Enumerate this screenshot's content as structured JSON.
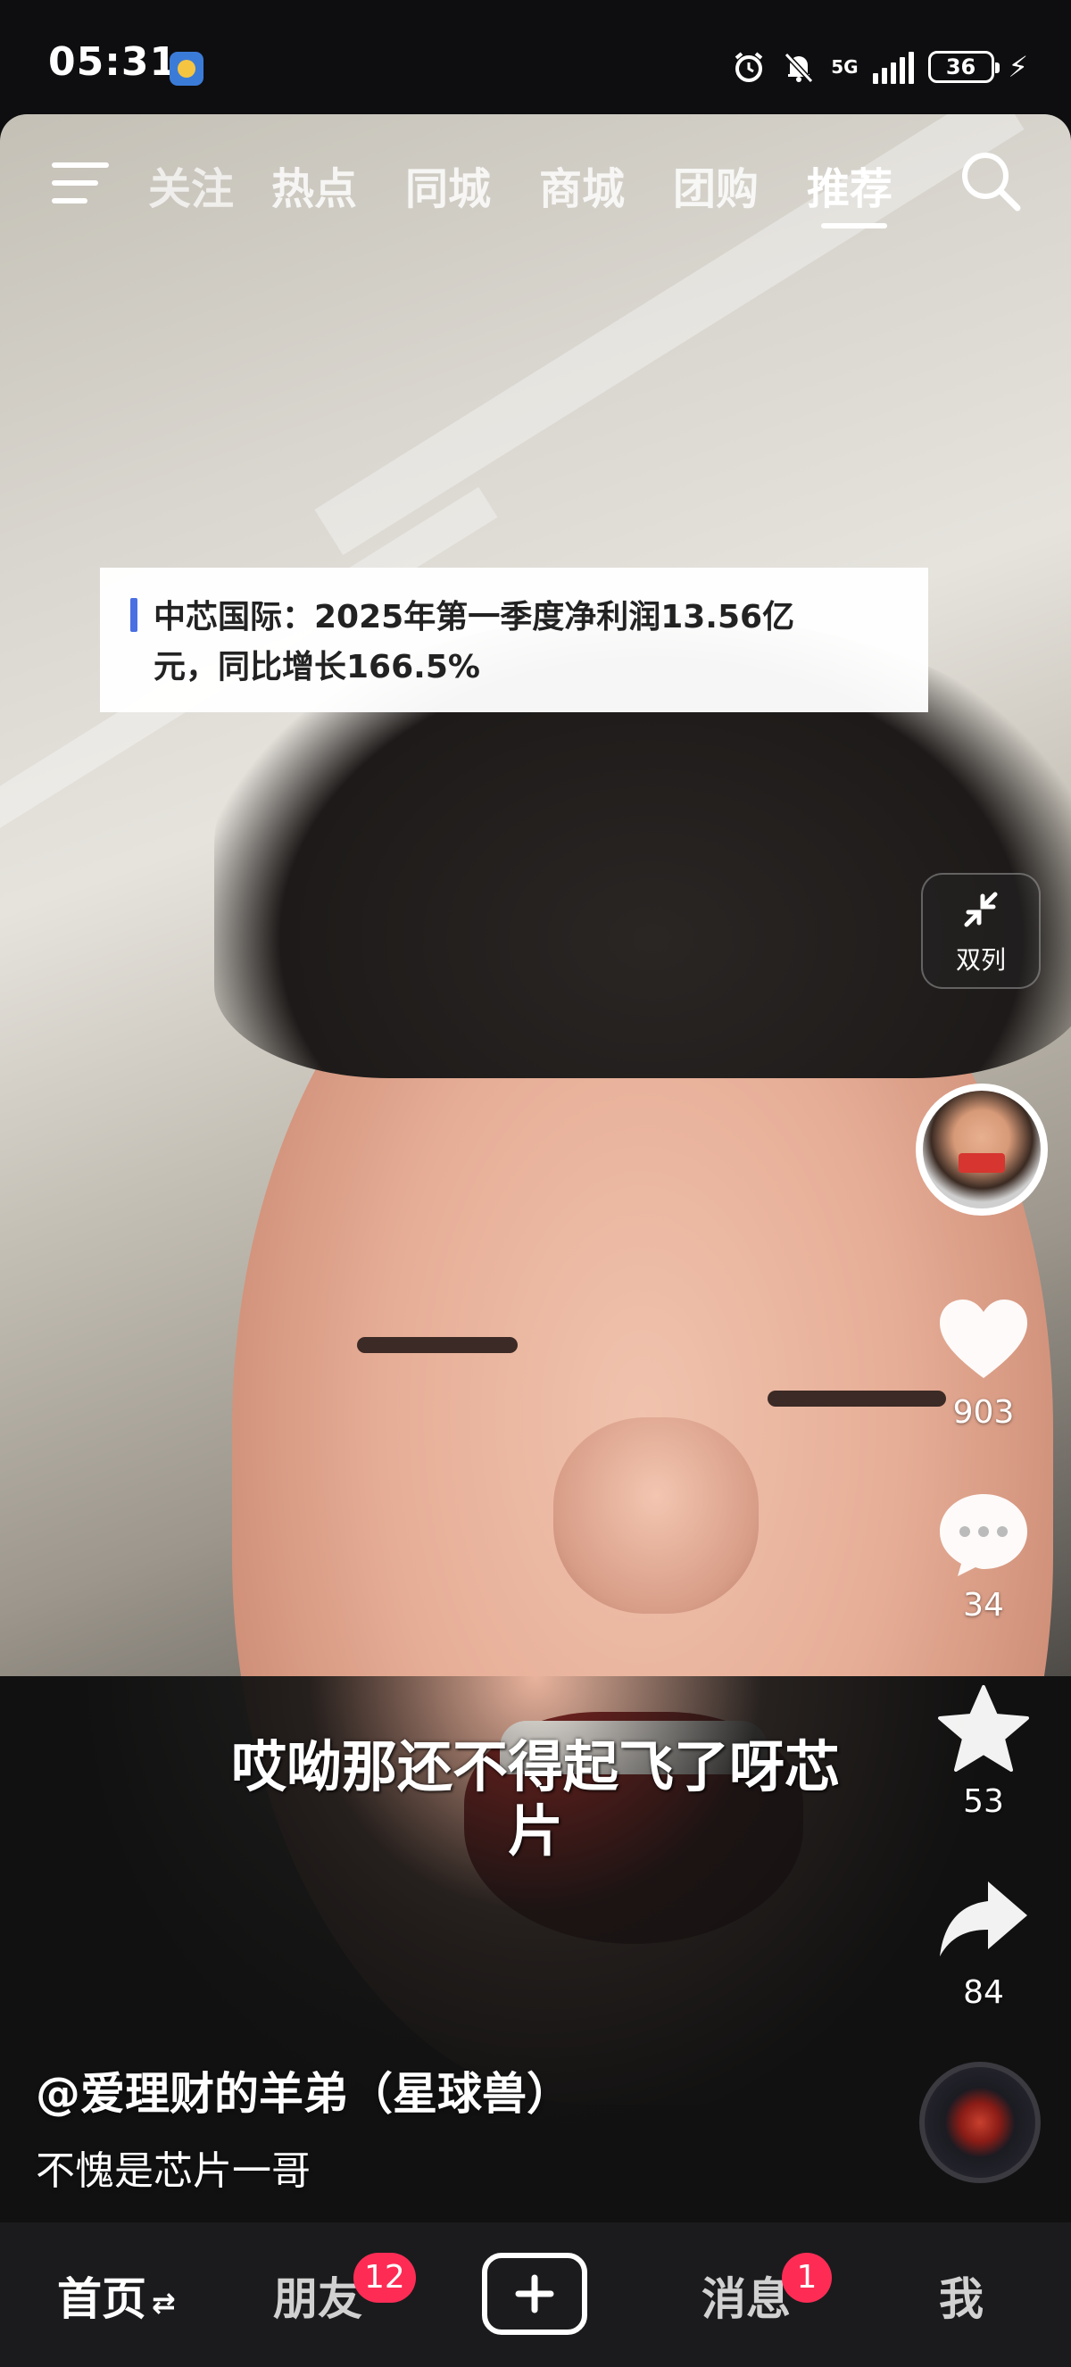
{
  "status_bar": {
    "time": "05:31",
    "network": "5G",
    "battery": "36"
  },
  "top_tabs": [
    {
      "label": "关注"
    },
    {
      "label": "热点"
    },
    {
      "label": "同城"
    },
    {
      "label": "商城"
    },
    {
      "label": "团购"
    },
    {
      "label": "推荐",
      "active": true
    }
  ],
  "news_card": {
    "line1": "中芯国际：2025年第一季度净利润13.56亿",
    "line2": "元，同比增长166.5%"
  },
  "side_actions": {
    "dual_label": "双列",
    "likes": "903",
    "comments": "34",
    "favorites": "53",
    "shares": "84"
  },
  "subtitle": {
    "line1": "哎呦那还不得起飞了呀芯",
    "line2": "片"
  },
  "post": {
    "author": "@爱理财的羊弟（星球兽）",
    "caption": "不愧是芯片一哥"
  },
  "bottom_nav": {
    "home": "首页",
    "friends": "朋友",
    "friends_badge": "12",
    "messages": "消息",
    "messages_badge": "1",
    "me": "我"
  },
  "colors": {
    "badge": "#fe2c55",
    "news_bar": "#4a6fe3"
  }
}
